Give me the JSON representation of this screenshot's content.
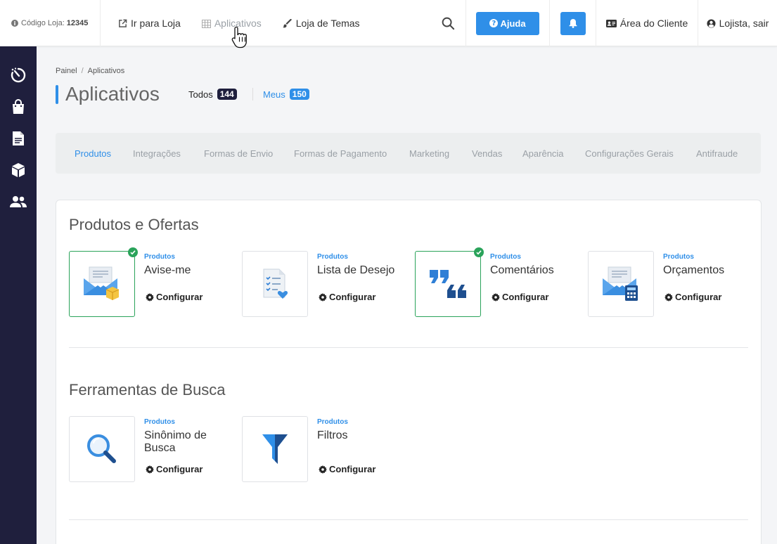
{
  "topbar": {
    "store_code_label": "Código Loja:",
    "store_code_value": "12345",
    "nav": [
      {
        "label": "Ir para Loja",
        "icon": "external-link-icon"
      },
      {
        "label": "Aplicativos",
        "icon": "grid-icon"
      },
      {
        "label": "Loja de Temas",
        "icon": "brush-icon"
      }
    ],
    "help_label": "Ajuda",
    "client_area_label": "Área do Cliente",
    "user_label": "Lojista, sair"
  },
  "sidebar": {
    "items": [
      "dashboard-icon",
      "shopping-bag-icon",
      "document-icon",
      "box-icon",
      "users-icon"
    ]
  },
  "breadcrumb": {
    "root": "Painel",
    "separator": "/",
    "current": "Aplicativos"
  },
  "page": {
    "title": "Aplicativos",
    "tabs": [
      {
        "label": "Todos",
        "count": "144"
      },
      {
        "label": "Meus",
        "count": "150"
      }
    ]
  },
  "categories": [
    "Produtos",
    "Integrações",
    "Formas de Envio",
    "Formas de Pagamento",
    "Marketing",
    "Vendas",
    "Aparência",
    "Configurações Gerais",
    "Antifraude"
  ],
  "sections": [
    {
      "title": "Produtos e Ofertas",
      "apps": [
        {
          "category": "Produtos",
          "name": "Avise-me",
          "action": "Configurar",
          "installed": true,
          "icon": "envelope-box-icon"
        },
        {
          "category": "Produtos",
          "name": "Lista de Desejo",
          "action": "Configurar",
          "installed": false,
          "icon": "checklist-heart-icon"
        },
        {
          "category": "Produtos",
          "name": "Comentários",
          "action": "Configurar",
          "installed": true,
          "icon": "quote-icon"
        },
        {
          "category": "Produtos",
          "name": "Orçamentos",
          "action": "Configurar",
          "installed": false,
          "icon": "envelope-calculator-icon"
        }
      ]
    },
    {
      "title": "Ferramentas de Busca",
      "apps": [
        {
          "category": "Produtos",
          "name": "Sinônimo de Busca",
          "action": "Configurar",
          "installed": false,
          "icon": "magnifier-icon"
        },
        {
          "category": "Produtos",
          "name": "Filtros",
          "action": "Configurar",
          "installed": false,
          "icon": "funnel-icon"
        }
      ]
    }
  ],
  "colors": {
    "accent": "#2f8fe8",
    "sidebar": "#1f1f3d",
    "installed": "#2aa35a"
  }
}
